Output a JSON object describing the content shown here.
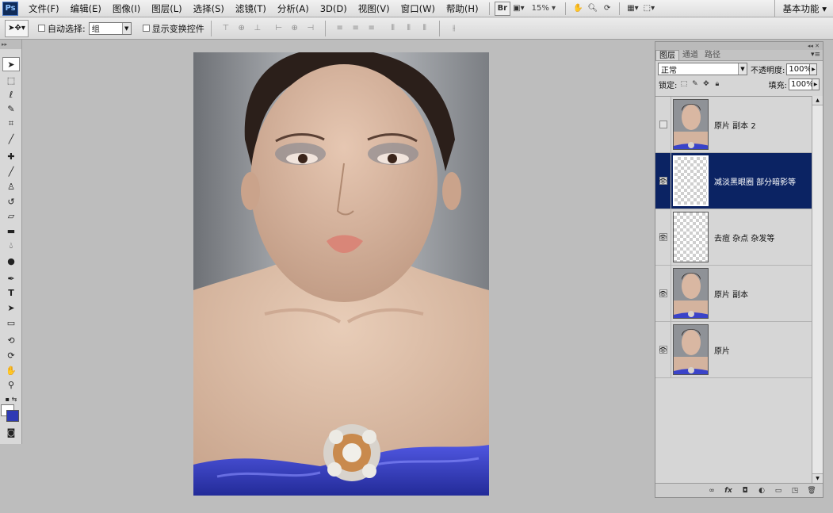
{
  "app": {
    "logo_text": "Ps"
  },
  "menu": [
    "文件(F)",
    "编辑(E)",
    "图像(I)",
    "图层(L)",
    "选择(S)",
    "滤镜(T)",
    "分析(A)",
    "3D(D)",
    "视图(V)",
    "窗口(W)",
    "帮助(H)"
  ],
  "menubar_tools": {
    "bridge_label": "Br",
    "zoom": "15%",
    "workspace": "基本功能"
  },
  "options": {
    "auto_select_label": "自动选择:",
    "auto_select_value": "组",
    "show_transform_label": "显示变换控件"
  },
  "tools": [
    "move-tool",
    "marquee-tool",
    "lasso-tool",
    "quick-select-tool",
    "crop-tool",
    "eyedropper-tool",
    "healing-brush-tool",
    "brush-tool",
    "clone-stamp-tool",
    "history-brush-tool",
    "eraser-tool",
    "gradient-tool",
    "blur-tool",
    "dodge-tool",
    "pen-tool",
    "type-tool",
    "path-selection-tool",
    "shape-tool",
    "3d-rotate-tool",
    "3d-orbit-tool",
    "hand-tool",
    "zoom-tool"
  ],
  "colors": {
    "foreground": "#ffffff",
    "background": "#2e3ab4",
    "selected_layer": "#0b2363"
  },
  "layers_panel": {
    "tabs": [
      "图层",
      "通道",
      "路径"
    ],
    "blend_mode": "正常",
    "opacity_label": "不透明度:",
    "opacity": "100%",
    "lock_label": "锁定:",
    "fill_label": "填充:",
    "fill": "100%",
    "layers": [
      {
        "name": "原片 副本 2",
        "visible": false,
        "thumb": "photo",
        "selected": false
      },
      {
        "name": "减淡黑眼圈 部分暗影等",
        "visible": true,
        "thumb": "transparent",
        "selected": true
      },
      {
        "name": "去痘 杂点 杂发等",
        "visible": true,
        "thumb": "transparent",
        "selected": false
      },
      {
        "name": "原片 副本",
        "visible": true,
        "thumb": "photo",
        "selected": false
      },
      {
        "name": "原片",
        "visible": true,
        "thumb": "photo",
        "selected": false
      }
    ],
    "bottom_icons": [
      "link-icon",
      "fx-icon",
      "mask-icon",
      "adjustment-icon",
      "group-folder-icon",
      "new-layer-icon",
      "trash-icon"
    ]
  }
}
